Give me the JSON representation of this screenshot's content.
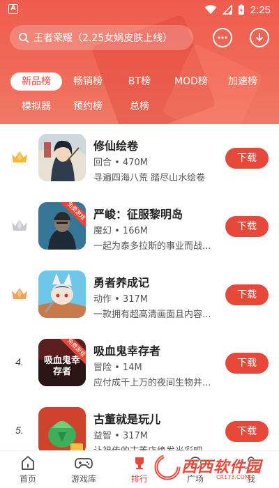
{
  "statusbar": {
    "time": "2:25",
    "left_badge": "A"
  },
  "search": {
    "placeholder": "王者荣耀（2.25女娲皮肤上线）"
  },
  "tabs": [
    {
      "label": "新品榜",
      "active": true
    },
    {
      "label": "畅销榜"
    },
    {
      "label": "BT榜"
    },
    {
      "label": "MOD榜"
    },
    {
      "label": "加速榜"
    },
    {
      "label": "模拟器"
    },
    {
      "label": "预约榜"
    },
    {
      "label": "总榜"
    }
  ],
  "games": [
    {
      "rank": "1",
      "name": "修仙绘卷",
      "meta": "回合 • 470M",
      "desc": "寻遍四海八荒 踏尽山水绘卷",
      "button": "下载"
    },
    {
      "rank": "2",
      "name": "严峻：征服黎明岛",
      "meta": "魔幻 • 166M",
      "desc": "一起为泰多拉斯的事业而战...",
      "button": "下载",
      "badge": "免费游戏"
    },
    {
      "rank": "3",
      "name": "勇者养成记",
      "meta": "动作 • 317M",
      "desc": "一款拥有超高清画面且内容...",
      "button": "下载"
    },
    {
      "rank": "4.",
      "name": "吸血鬼幸存者",
      "meta": "冒险 • 14M",
      "desc": "应付成千上万的夜间生物并...",
      "button": "下载",
      "badge": "免费游戏",
      "thumb_text": "吸血鬼幸存者"
    },
    {
      "rank": "5.",
      "name": "古董就是玩儿",
      "meta": "益智 • 317M",
      "desc": "让祖传的古董店焕发光彩吧",
      "button": "下载"
    }
  ],
  "bottomnav": [
    {
      "label": "首页"
    },
    {
      "label": "游戏库"
    },
    {
      "label": "排行",
      "active": true
    },
    {
      "label": "广场"
    },
    {
      "label": "我"
    }
  ],
  "watermark": {
    "text": "西西软件园",
    "url": "CR173.COM"
  },
  "colors": {
    "brand": "#e8483a",
    "header": "#ef5c4d"
  }
}
